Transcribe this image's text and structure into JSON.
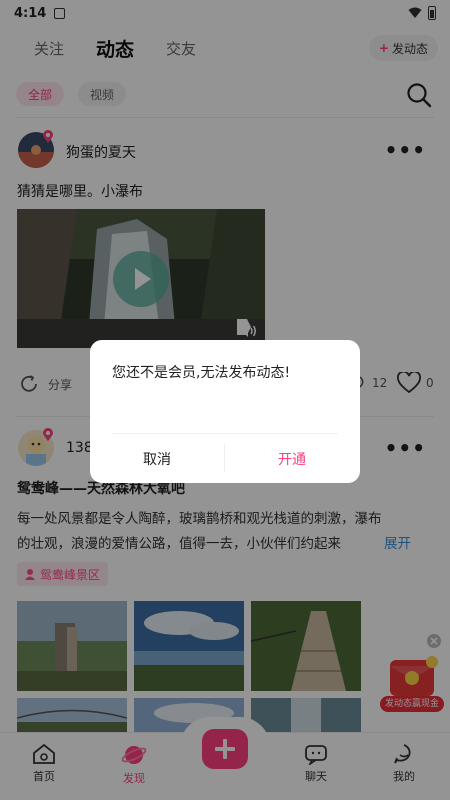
{
  "status": {
    "time": "4:14"
  },
  "top_tabs": [
    {
      "label": "关注",
      "active": false
    },
    {
      "label": "动态",
      "active": true
    },
    {
      "label": "交友",
      "active": false
    }
  ],
  "post_button_label": "发动态",
  "filters": [
    {
      "label": "全部",
      "active": true
    },
    {
      "label": "视频",
      "active": false
    }
  ],
  "post1": {
    "username": "狗蛋的夏天",
    "text": "猜猜是哪里。小瀑布",
    "share_label": "分享",
    "comments": "12",
    "likes": "0"
  },
  "post2": {
    "username": "138",
    "title": "鸳鸯峰——天然森林大氧吧",
    "body_line1": "每一处风景都是令人陶醉，玻璃鹊桥和观光栈道的刺激，瀑布",
    "body_line2": "的壮观，浪漫的爱情公路，值得一去，小伙伴们约起来",
    "expand_label": "展开",
    "location": "鸳鸯峰景区"
  },
  "promo_label": "发动态赢现金",
  "bottom_nav": [
    {
      "label": "首页",
      "icon": "home-icon"
    },
    {
      "label": "发现",
      "icon": "planet-icon",
      "active": true
    },
    {
      "label": "聊天",
      "icon": "chat-icon"
    },
    {
      "label": "我的",
      "icon": "profile-icon"
    }
  ],
  "dialog": {
    "message": "您还不是会员,无法发布动态!",
    "cancel_label": "取消",
    "confirm_label": "开通"
  },
  "colors": {
    "accent": "#ff3e7f",
    "chip_bg": "#ffe6ef"
  }
}
